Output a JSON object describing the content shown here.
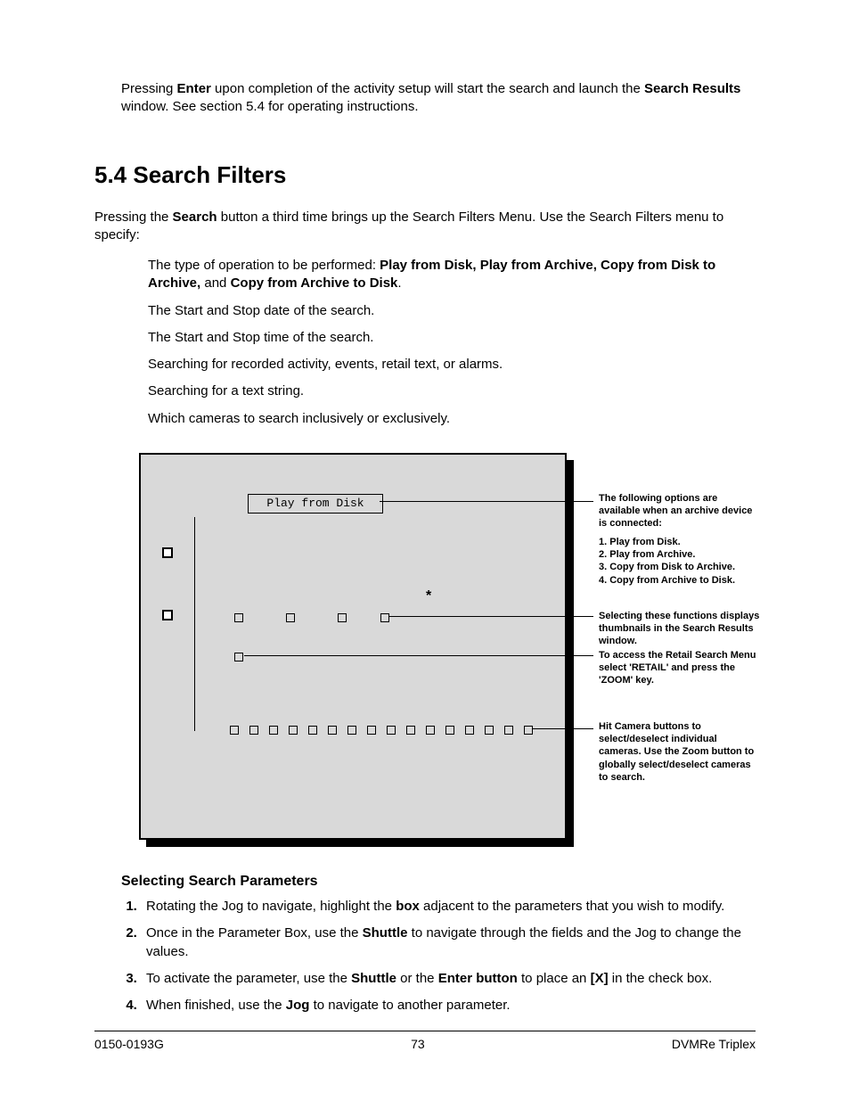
{
  "intro": {
    "pre": "Pressing ",
    "b1": "Enter",
    "mid": " upon completion of the activity setup will start the search and launch the ",
    "b2": "Search Results",
    "post": " window. See section 5.4 for operating instructions."
  },
  "section_number": "5.4",
  "section_title": "Search Filters",
  "lead": {
    "pre": "Pressing the ",
    "b1": "Search",
    "post": " button a third time brings up the Search Filters Menu. Use the Search Filters menu to specify:"
  },
  "bullets": {
    "b0_pre": "The type of operation to be performed: ",
    "b0_b1": "Play from Disk, Play from Archive, Copy from Disk to Archive,",
    "b0_mid": " and ",
    "b0_b2": "Copy from Archive to Disk",
    "b0_post": ".",
    "b1": "The Start and Stop date of the search.",
    "b2": "The Start and Stop time of the search.",
    "b3": "Searching for recorded activity, events, retail text, or alarms.",
    "b4": "Searching for a text string.",
    "b5": "Which cameras to search inclusively or exclusively."
  },
  "diagram": {
    "play_label": "Play from Disk",
    "annot1_intro": "The following options are available when an archive device is connected:",
    "annot1_opts": [
      "1. Play from Disk.",
      "2. Play from Archive.",
      "3. Copy from Disk to Archive.",
      "4. Copy from Archive to Disk."
    ],
    "annot2": "Selecting these functions displays thumbnails in the Search Results window.",
    "annot3": "To access the Retail Search Menu select 'RETAIL' and press the 'ZOOM' key.",
    "annot4": "Hit Camera buttons to select/deselect individual cameras. Use the Zoom button to globally select/deselect cameras to search."
  },
  "subhead": "Selecting Search Parameters",
  "steps": {
    "s1_pre": "Rotating the Jog to navigate, highlight the ",
    "s1_b1": "box",
    "s1_post": " adjacent to the parameters that you wish to modify.",
    "s2_pre": "Once in the Parameter Box, use the ",
    "s2_b1": "Shuttle",
    "s2_post": " to navigate through the fields and the Jog to change the values.",
    "s3_pre": "To activate the parameter, use the ",
    "s3_b1": "Shuttle",
    "s3_mid": " or the ",
    "s3_b2": "Enter button",
    "s3_mid2": " to place an ",
    "s3_b3": "[X]",
    "s3_post": " in the check box.",
    "s4_pre": "When finished, use the ",
    "s4_b1": "Jog",
    "s4_post": " to navigate to another parameter."
  },
  "footer": {
    "left": "0150-0193G",
    "center": "73",
    "right": "DVMRe Triplex"
  }
}
